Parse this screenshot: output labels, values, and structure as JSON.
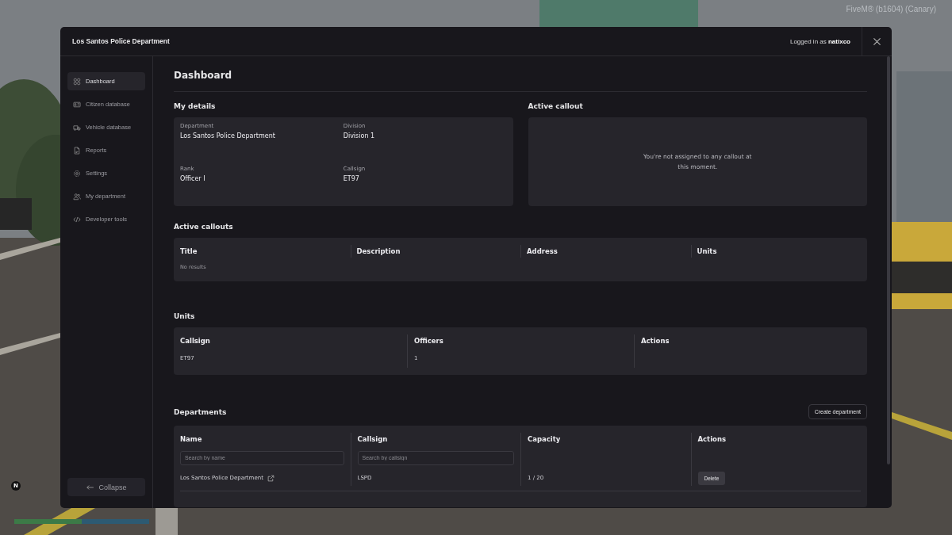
{
  "overlay": {
    "client_version": "FiveM® (b1604) (Canary)",
    "compass": "N"
  },
  "hud": {
    "bars": [
      {
        "kind": "health",
        "level": 1
      },
      {
        "kind": "armor",
        "level": 1
      }
    ]
  },
  "window": {
    "title": "Los Santos Police Department",
    "user": "Logged in as **natixco**"
  },
  "sidebar": {
    "items": [
      {
        "label": "Dashboard",
        "selected": true
      },
      {
        "label": "Citizen database",
        "selected": false
      },
      {
        "label": "Vehicle database",
        "selected": false
      },
      {
        "label": "Reports",
        "selected": false
      },
      {
        "label": "Settings",
        "selected": false
      },
      {
        "label": "My department",
        "selected": false
      },
      {
        "label": "Developer tools",
        "selected": false
      }
    ],
    "collapse_button": "Collapse"
  },
  "page_title": "Dashboard",
  "my_details": {
    "heading": "My details",
    "fields": [
      {
        "label": "Department",
        "value": "Los Santos Police Department"
      },
      {
        "label": "Division",
        "value": "Division 1"
      },
      {
        "label": "Rank",
        "value": "Officer I"
      },
      {
        "label": "Callsign",
        "value": "ET97"
      }
    ]
  },
  "active_callout": {
    "heading": "Active callout",
    "message": "You're not assigned to any callout at this moment."
  },
  "active_callouts": {
    "heading": "Active callouts",
    "columns": [
      "Title",
      "Description",
      "Address",
      "Units"
    ],
    "empty_text": "No results"
  },
  "units": {
    "heading": "Units",
    "columns": [
      "Callsign",
      "Officers",
      "Actions"
    ],
    "rows": [
      [
        "ET97",
        "1"
      ]
    ]
  },
  "departments": {
    "heading": "Departments",
    "create_button": "Create department",
    "columns": [
      {
        "label": "Name",
        "placeholder": "Search by name"
      },
      {
        "label": "Callsign",
        "placeholder": "Search by callsign"
      },
      {
        "label": "Capacity"
      },
      {
        "label": "Actions"
      }
    ],
    "rows": [
      {
        "name": "Los Santos Police Department",
        "callsign": "LSPD",
        "capacity": "1 / 20",
        "action": "Delete"
      }
    ]
  }
}
